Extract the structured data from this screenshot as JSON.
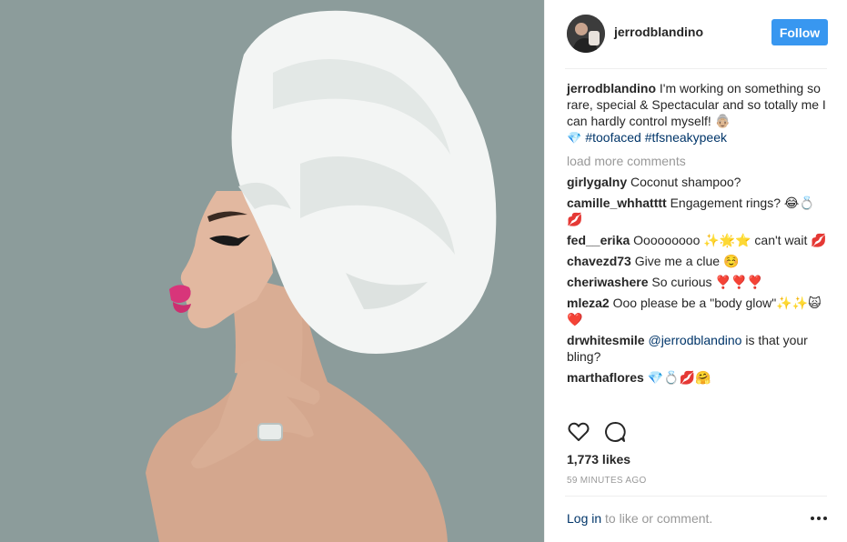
{
  "post": {
    "image_alt": "Woman in profile wearing a white towel wrapped on her head"
  },
  "header": {
    "username": "jerrodblandino",
    "follow_label": "Follow",
    "follow_color": "#3897f0"
  },
  "caption": {
    "user": "jerrodblandino",
    "text": " I'm working on something so rare, special & Spectacular and so totally me I can hardly control myself! 👵🏼",
    "emoji_prefix": "💎 ",
    "hashtags": [
      "#toofaced",
      "#tfsneakypeek"
    ]
  },
  "load_more": "load more comments",
  "comments": [
    {
      "user": "girlygalny",
      "text": " Coconut shampoo?"
    },
    {
      "user": "camille_whhatttt",
      "text": " Engagement rings? 😂💍💋"
    },
    {
      "user": "fed__erika",
      "text": " Ooooooooo ✨🌟⭐️ can't wait 💋"
    },
    {
      "user": "chavezd73",
      "text": " Give me a clue ☺️"
    },
    {
      "user": "cheriwashere",
      "text": " So curious ❣️❣️❣️"
    },
    {
      "user": "mleza2",
      "text": " Ooo please be a \"body glow\"✨✨🙀❤️"
    },
    {
      "user": "drwhitesmile",
      "mention": "@jerrodblandino",
      "text": " is that your bling?"
    },
    {
      "user": "marthaflores",
      "text": " 💎💍💋🤗"
    }
  ],
  "actions": {
    "like_icon": "heart-outline-icon",
    "comment_icon": "comment-bubble-icon"
  },
  "likes": "1,773 likes",
  "timestamp": "59 MINUTES AGO",
  "footer": {
    "login_link": "Log in",
    "login_suffix": " to like or comment.",
    "more_icon": "ellipsis-icon"
  }
}
